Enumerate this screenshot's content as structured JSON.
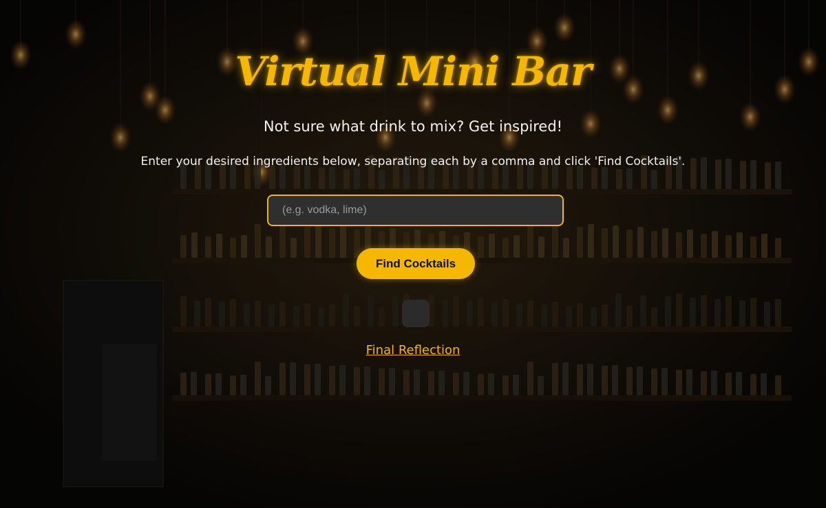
{
  "app": {
    "title": "Virtual Mini Bar",
    "subtitle": "Not sure what drink to mix? Get inspired!",
    "instructions": "Enter your desired ingredients below, separating each by a comma and click 'Find Cocktails'."
  },
  "search": {
    "value": "",
    "placeholder": "(e.g. vodka, lime)"
  },
  "actions": {
    "find_label": "Find Cocktails",
    "reflection_link": "Final Reflection"
  },
  "colors": {
    "accent": "#f5b700",
    "input_background": "#2f2f2f",
    "text": "#f2f2f2",
    "page_background": "#0c0b09"
  }
}
